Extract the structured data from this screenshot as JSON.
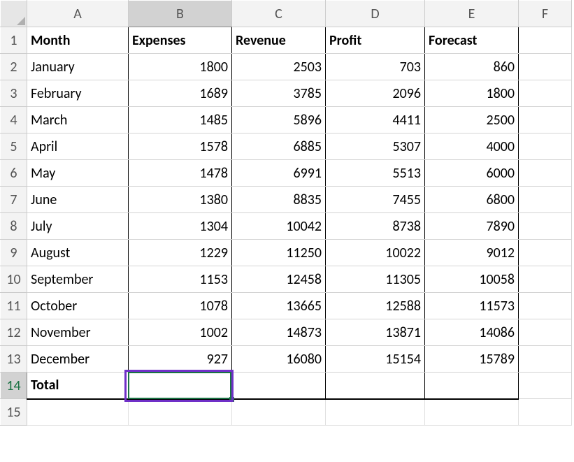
{
  "columns": [
    "A",
    "B",
    "C",
    "D",
    "E",
    "F"
  ],
  "row_numbers": [
    1,
    2,
    3,
    4,
    5,
    6,
    7,
    8,
    9,
    10,
    11,
    12,
    13,
    14,
    15
  ],
  "headers": [
    "Month",
    "Expenses",
    "Revenue",
    "Profit",
    "Forecast"
  ],
  "rows": [
    {
      "month": "January",
      "expenses": 1800,
      "revenue": 2503,
      "profit": 703,
      "forecast": 860
    },
    {
      "month": "February",
      "expenses": 1689,
      "revenue": 3785,
      "profit": 2096,
      "forecast": 1800
    },
    {
      "month": "March",
      "expenses": 1485,
      "revenue": 5896,
      "profit": 4411,
      "forecast": 2500
    },
    {
      "month": "April",
      "expenses": 1578,
      "revenue": 6885,
      "profit": 5307,
      "forecast": 4000
    },
    {
      "month": "May",
      "expenses": 1478,
      "revenue": 6991,
      "profit": 5513,
      "forecast": 6000
    },
    {
      "month": "June",
      "expenses": 1380,
      "revenue": 8835,
      "profit": 7455,
      "forecast": 6800
    },
    {
      "month": "July",
      "expenses": 1304,
      "revenue": 10042,
      "profit": 8738,
      "forecast": 7890
    },
    {
      "month": "August",
      "expenses": 1229,
      "revenue": 11250,
      "profit": 10022,
      "forecast": 9012
    },
    {
      "month": "September",
      "expenses": 1153,
      "revenue": 12458,
      "profit": 11305,
      "forecast": 10058
    },
    {
      "month": "October",
      "expenses": 1078,
      "revenue": 13665,
      "profit": 12588,
      "forecast": 11573
    },
    {
      "month": "November",
      "expenses": 1002,
      "revenue": 14873,
      "profit": 13871,
      "forecast": 14086
    },
    {
      "month": "December",
      "expenses": 927,
      "revenue": 16080,
      "profit": 15154,
      "forecast": 15789
    }
  ],
  "total_label": "Total",
  "selected_cell": "B14",
  "selected_column": "B",
  "selected_row": 14,
  "colors": {
    "grid": "#d4d4d4",
    "header_bg": "#f3f3f3",
    "active_border": "#1a7243",
    "highlight_box": "#7030c8"
  }
}
